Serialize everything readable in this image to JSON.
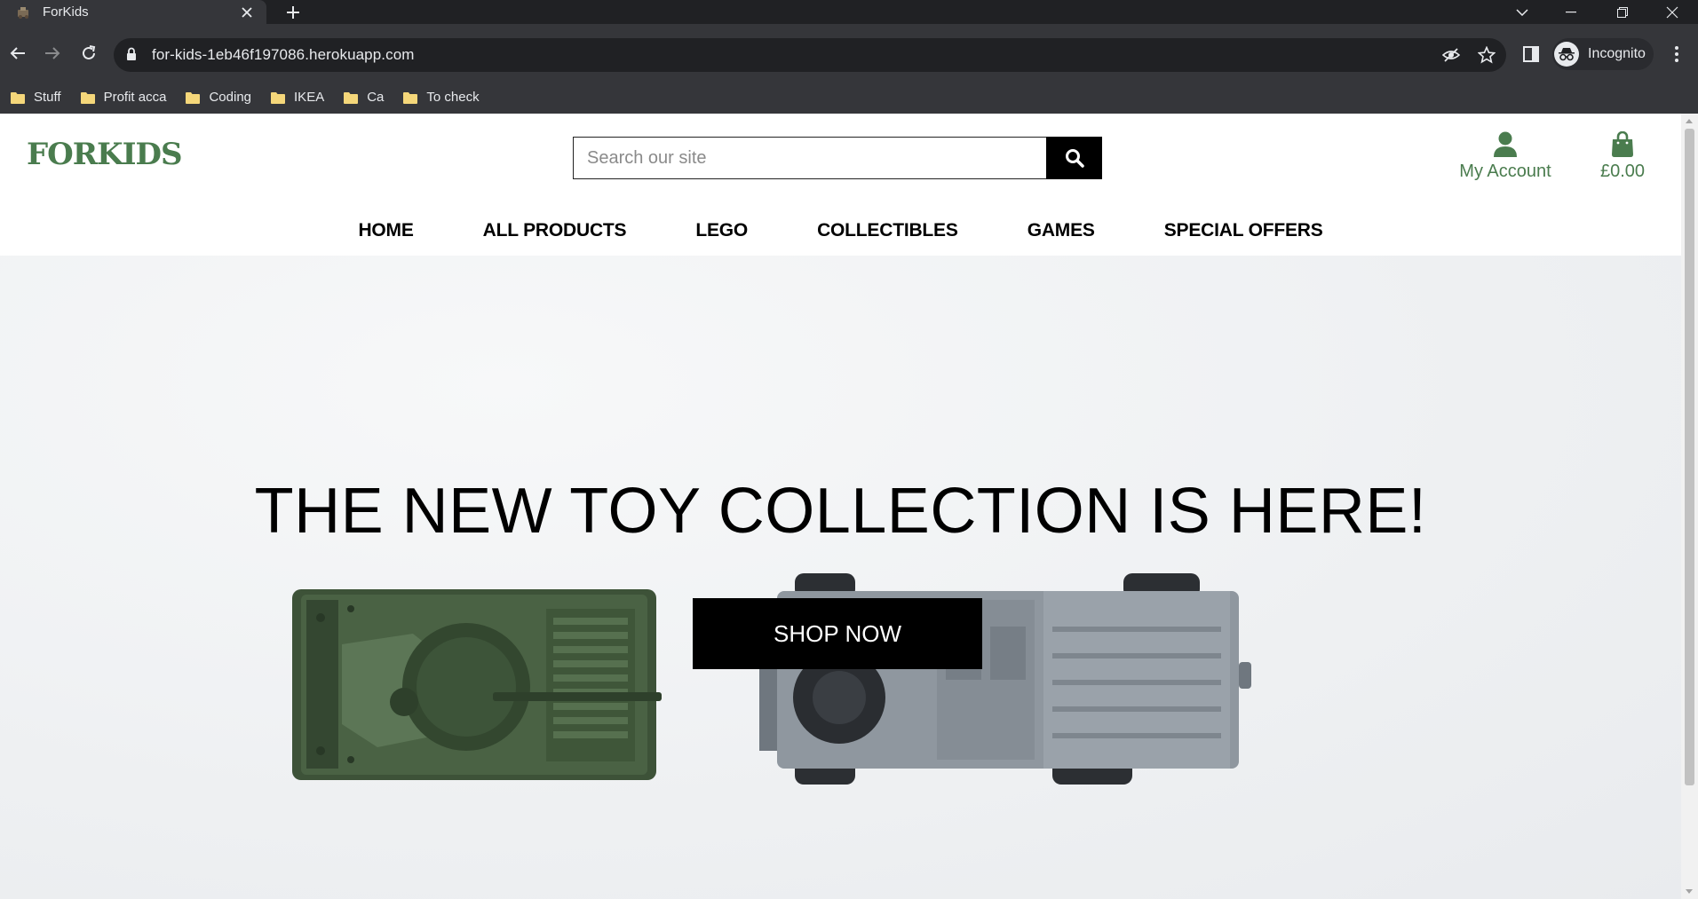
{
  "browser": {
    "tab_title": "ForKids",
    "url": "for-kids-1eb46f197086.herokuapp.com",
    "profile_label": "Incognito",
    "bookmarks": [
      {
        "label": "Stuff"
      },
      {
        "label": "Profit acca"
      },
      {
        "label": "Coding"
      },
      {
        "label": "IKEA"
      },
      {
        "label": "Ca"
      },
      {
        "label": "To check"
      }
    ]
  },
  "site": {
    "logo": "FORKIDS",
    "search": {
      "placeholder": "Search our site"
    },
    "account_label": "My Account",
    "bag_total": "£0.00",
    "nav": [
      {
        "label": "HOME"
      },
      {
        "label": "ALL PRODUCTS"
      },
      {
        "label": "LEGO"
      },
      {
        "label": "COLLECTIBLES"
      },
      {
        "label": "GAMES"
      },
      {
        "label": "SPECIAL OFFERS"
      }
    ],
    "hero": {
      "title": "THE NEW TOY COLLECTION IS HERE!",
      "button": "SHOP NOW"
    }
  },
  "colors": {
    "brand_green": "#4a7c4e",
    "chrome_dark": "#202124",
    "chrome_mid": "#35363a"
  }
}
